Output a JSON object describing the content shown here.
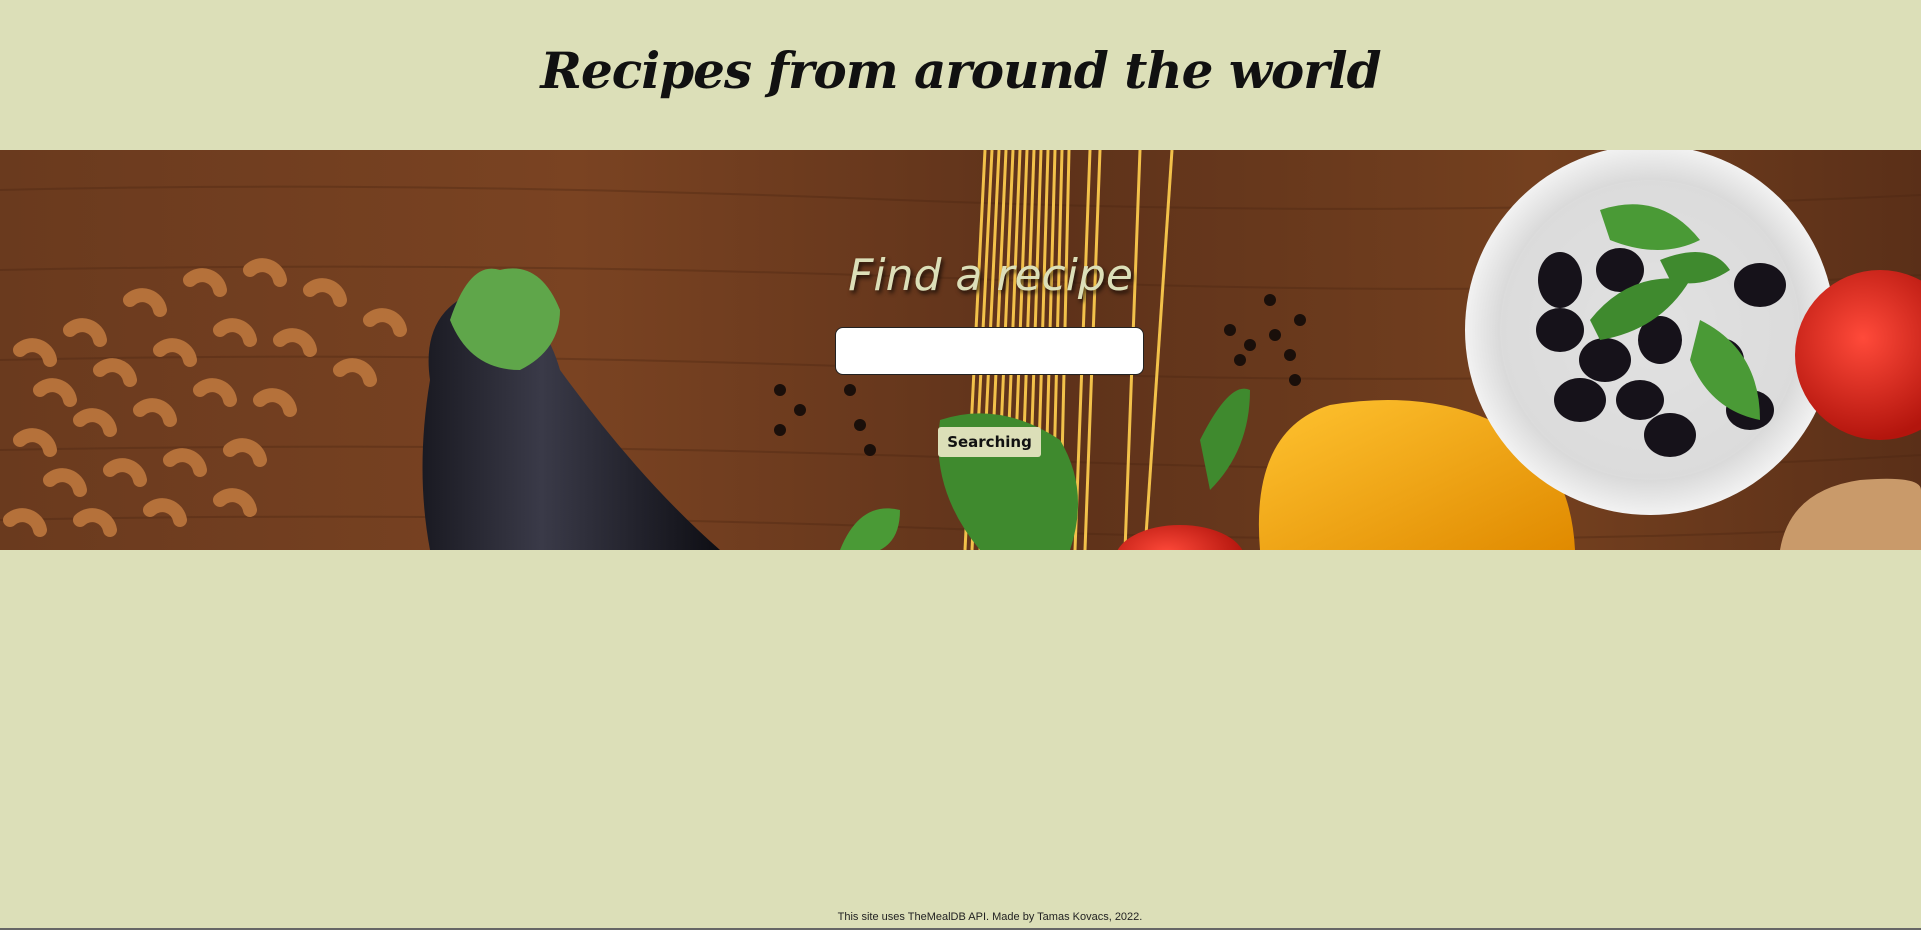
{
  "header": {
    "title": "Recipes from around the world"
  },
  "hero": {
    "background_image": "food-ingredients-on-wooden-table",
    "search": {
      "heading": "Find a recipe",
      "input_value": "",
      "button_label": "Searching"
    }
  },
  "footer": {
    "text": "This site uses TheMealDB API. Made by Tamas Kovacs, 2022."
  },
  "colors": {
    "page_background": "#dcdfb8",
    "heading_text": "#dcdfb8",
    "button_background": "#dcdfb8",
    "wood": "#6b3a1f"
  }
}
